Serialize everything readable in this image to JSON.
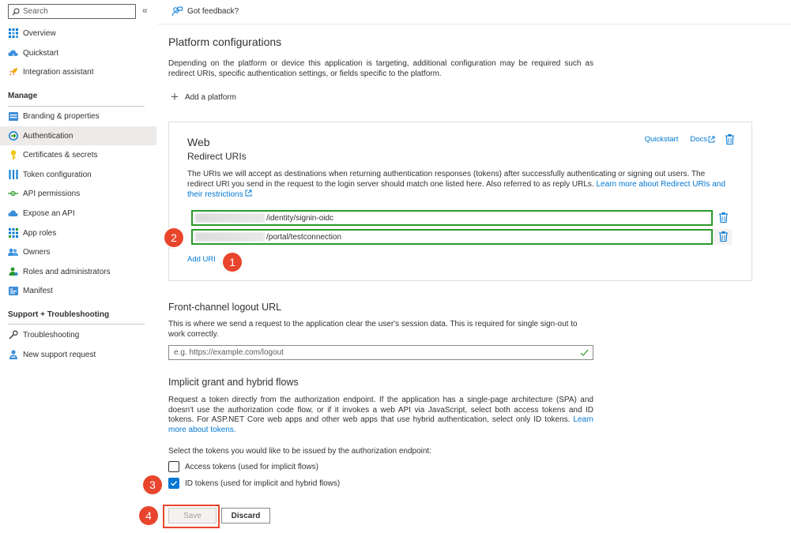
{
  "sidebar": {
    "search_placeholder": "Search",
    "collapse_glyph": "«",
    "items_top": [
      {
        "label": "Overview",
        "icon": "overview-grid-icon"
      },
      {
        "label": "Quickstart",
        "icon": "quickstart-cloud-icon"
      },
      {
        "label": "Integration assistant",
        "icon": "rocket-icon"
      }
    ],
    "manage_heading": "Manage",
    "items_manage": [
      {
        "label": "Branding & properties",
        "icon": "branding-icon"
      },
      {
        "label": "Authentication",
        "icon": "authentication-icon",
        "selected": true
      },
      {
        "label": "Certificates & secrets",
        "icon": "key-icon"
      },
      {
        "label": "Token configuration",
        "icon": "token-bars-icon"
      },
      {
        "label": "API permissions",
        "icon": "api-permissions-icon"
      },
      {
        "label": "Expose an API",
        "icon": "cloud-icon"
      },
      {
        "label": "App roles",
        "icon": "app-roles-grid-icon"
      },
      {
        "label": "Owners",
        "icon": "owners-people-icon"
      },
      {
        "label": "Roles and administrators",
        "icon": "roles-person-icon"
      },
      {
        "label": "Manifest",
        "icon": "manifest-icon"
      }
    ],
    "support_heading": "Support + Troubleshooting",
    "items_support": [
      {
        "label": "Troubleshooting",
        "icon": "wrench-icon"
      },
      {
        "label": "New support request",
        "icon": "support-person-icon"
      }
    ]
  },
  "header": {
    "feedback_label": "Got feedback?"
  },
  "platform": {
    "title": "Platform configurations",
    "description": "Depending on the platform or device this application is targeting, additional configuration may be required such as redirect URIs, specific authentication settings, or fields specific to the platform.",
    "add_platform_label": "Add a platform"
  },
  "web_card": {
    "title": "Web",
    "redirect_title": "Redirect URIs",
    "quickstart_label": "Quickstart",
    "docs_label": "Docs",
    "description": "The URIs we will accept as destinations when returning authentication responses (tokens) after successfully authenticating or signing out users. The redirect URI you send in the request to the login server should match one listed here. Also referred to as reply URLs.",
    "learn_more_label": "Learn more about Redirect URIs and their restrictions",
    "redirect_uris": [
      {
        "value": "/identity/signin-oidc"
      },
      {
        "value": "/portal/testconnection"
      }
    ],
    "add_uri_label": "Add URI"
  },
  "logout": {
    "title": "Front-channel logout URL",
    "description": "This is where we send a request to the application clear the user's session data. This is required for single sign-out to work correctly.",
    "placeholder": "e.g. https://example.com/logout"
  },
  "implicit": {
    "title": "Implicit grant and hybrid flows",
    "description": "Request a token directly from the authorization endpoint. If the application has a single-page architecture (SPA) and doesn't use the authorization code flow, or if it invokes a web API via JavaScript, select both access tokens and ID tokens. For ASP.NET Core web apps and other web apps that use hybrid authentication, select only ID tokens.",
    "learn_more_label": "Learn more about tokens.",
    "select_prompt": "Select the tokens you would like to be issued by the authorization endpoint:",
    "access_tokens_label": "Access tokens (used for implicit flows)",
    "access_tokens_checked": false,
    "id_tokens_label": "ID tokens (used for implicit and hybrid flows)",
    "id_tokens_checked": true
  },
  "footer": {
    "save_label": "Save",
    "discard_label": "Discard"
  },
  "annotations": {
    "step1": "1",
    "step2": "2",
    "step3": "3",
    "step4": "4"
  },
  "colors": {
    "accent": "#0078d4",
    "callout": "#e8452c",
    "valid_border": "#2b9a2b",
    "selected_nav": "#edebe9"
  }
}
